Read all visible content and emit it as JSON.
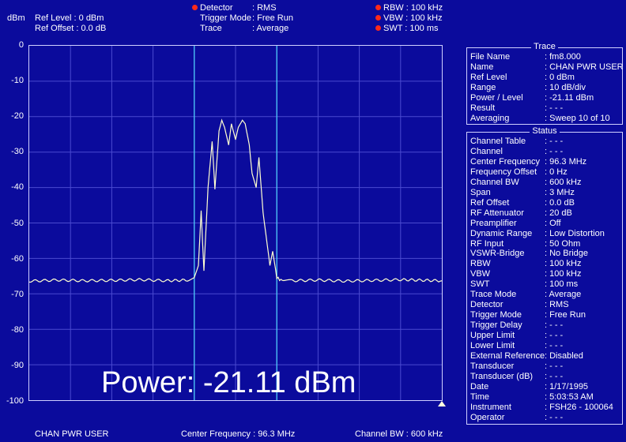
{
  "header": {
    "unit": "dBm",
    "ref_level": "Ref Level : 0   dBm",
    "ref_offset": "Ref Offset : 0.0 dB",
    "detector_label": "Detector",
    "detector_value": ": RMS",
    "trigger_label": "Trigger Mode",
    "trigger_value": ": Free Run",
    "trace_label": "Trace",
    "trace_value": ": Average",
    "rbw": "RBW : 100 kHz",
    "vbw": "VBW : 100 kHz",
    "swt": "SWT : 100 ms",
    "indicator_color": "#ff2a1a"
  },
  "chart_data": {
    "type": "line",
    "title": "",
    "xlabel": "",
    "ylabel": "dBm",
    "y_ticks": [
      "0",
      "-10",
      "-20",
      "-30",
      "-40",
      "-50",
      "-60",
      "-70",
      "-80",
      "-90",
      "-100"
    ],
    "ylim": [
      -100,
      0
    ],
    "xlim": [
      94.8,
      97.8
    ],
    "x_unit": "MHz",
    "grid": true,
    "x_divisions": 10,
    "y_divisions": 10,
    "trace_color": "#ffffd0",
    "grid_color": "#4a4ad0",
    "channel_bound_color": "#4fd8ff",
    "channel_bounds_mhz": [
      96.0,
      96.6
    ],
    "noise_floor_dbm": -66.2,
    "series": [
      {
        "x": [
          94.8,
          95.0,
          95.2,
          95.4,
          95.6,
          95.8,
          95.95,
          96.0,
          96.03,
          96.05,
          96.07,
          96.1,
          96.13,
          96.15,
          96.18,
          96.2,
          96.22,
          96.25,
          96.27,
          96.3,
          96.32,
          96.35,
          96.37,
          96.4,
          96.42,
          96.45,
          96.47,
          96.5,
          96.52,
          96.55,
          96.57,
          96.6,
          96.62,
          96.65,
          96.7,
          96.9,
          97.1,
          97.3,
          97.5,
          97.8
        ],
        "values": [
          -66.4,
          -66.1,
          -66.3,
          -66.2,
          -66.0,
          -66.3,
          -66.1,
          -65.5,
          -62,
          -46.5,
          -63.5,
          -40,
          -27,
          -40.5,
          -24,
          -21,
          -23,
          -28,
          -22,
          -26.5,
          -23,
          -21,
          -22,
          -28,
          -36,
          -40,
          -31.5,
          -47,
          -53,
          -62,
          -58,
          -65.3,
          -66.0,
          -66.2,
          -66.3,
          -66.1,
          -66.4,
          -66.2,
          -66.0,
          -66.3
        ]
      }
    ]
  },
  "power_label": "Power: -21.11 dBm",
  "trace_panel": {
    "title": "Trace",
    "rows": [
      {
        "k": "File Name",
        "v": ": fm8.000"
      },
      {
        "k": "Name",
        "v": ": CHAN PWR USER"
      },
      {
        "k": "Ref Level",
        "v": ":     0     dBm"
      },
      {
        "k": "Range",
        "v": ": 10 dB/div"
      },
      {
        "k": "Power / Level",
        "v": ":  -21.11 dBm"
      },
      {
        "k": "Result",
        "v": ": - - -"
      },
      {
        "k": "Averaging",
        "v": ": Sweep 10 of 10"
      }
    ]
  },
  "status_panel": {
    "title": "Status",
    "rows": [
      {
        "k": "Channel Table",
        "v": ": - - -"
      },
      {
        "k": "Channel",
        "v": ": - - -"
      },
      {
        "k": "Center Frequency",
        "v": ":   96.3   MHz"
      },
      {
        "k": "Frequency Offset",
        "v": ":     0     Hz"
      },
      {
        "k": "Channel BW",
        "v": ": 600     kHz"
      },
      {
        "k": "Span",
        "v": ":     3     MHz"
      },
      {
        "k": "Ref Offset",
        "v": ":    0.0   dB"
      },
      {
        "k": "RF Attenuator",
        "v": ":   20     dB"
      },
      {
        "k": "Preamplifier",
        "v": ": Off"
      },
      {
        "k": "Dynamic Range",
        "v": ": Low Distortion"
      },
      {
        "k": "RF Input",
        "v": ":    50     Ohm"
      },
      {
        "k": "VSWR-Bridge",
        "v": ": No Bridge"
      },
      {
        "k": "RBW",
        "v": ": 100     kHz"
      },
      {
        "k": "VBW",
        "v": ": 100     kHz"
      },
      {
        "k": "SWT",
        "v": ": 100     ms"
      },
      {
        "k": "Trace Mode",
        "v": ": Average"
      },
      {
        "k": "Detector",
        "v": ": RMS"
      },
      {
        "k": "Trigger Mode",
        "v": ": Free Run"
      },
      {
        "k": "Trigger Delay",
        "v": ": - - -"
      },
      {
        "k": "Upper Limit",
        "v": ": - - -"
      },
      {
        "k": "Lower Limit",
        "v": ": - - -"
      },
      {
        "k": "External Reference",
        "v": ": Disabled"
      },
      {
        "k": "Transducer",
        "v": ": - - -"
      },
      {
        "k": "Transducer (dB)",
        "v": ": - - -"
      },
      {
        "k": "Date",
        "v": ": 1/17/1995"
      },
      {
        "k": "Time",
        "v": ": 5:03:53 AM"
      },
      {
        "k": "Instrument",
        "v": ": FSH26 - 100064"
      },
      {
        "k": "Operator",
        "v": ": - - -"
      }
    ]
  },
  "footer": {
    "mode": "CHAN PWR USER",
    "center_freq": "Center Frequency : 96.3 MHz",
    "channel_bw": "Channel BW : 600 kHz"
  }
}
